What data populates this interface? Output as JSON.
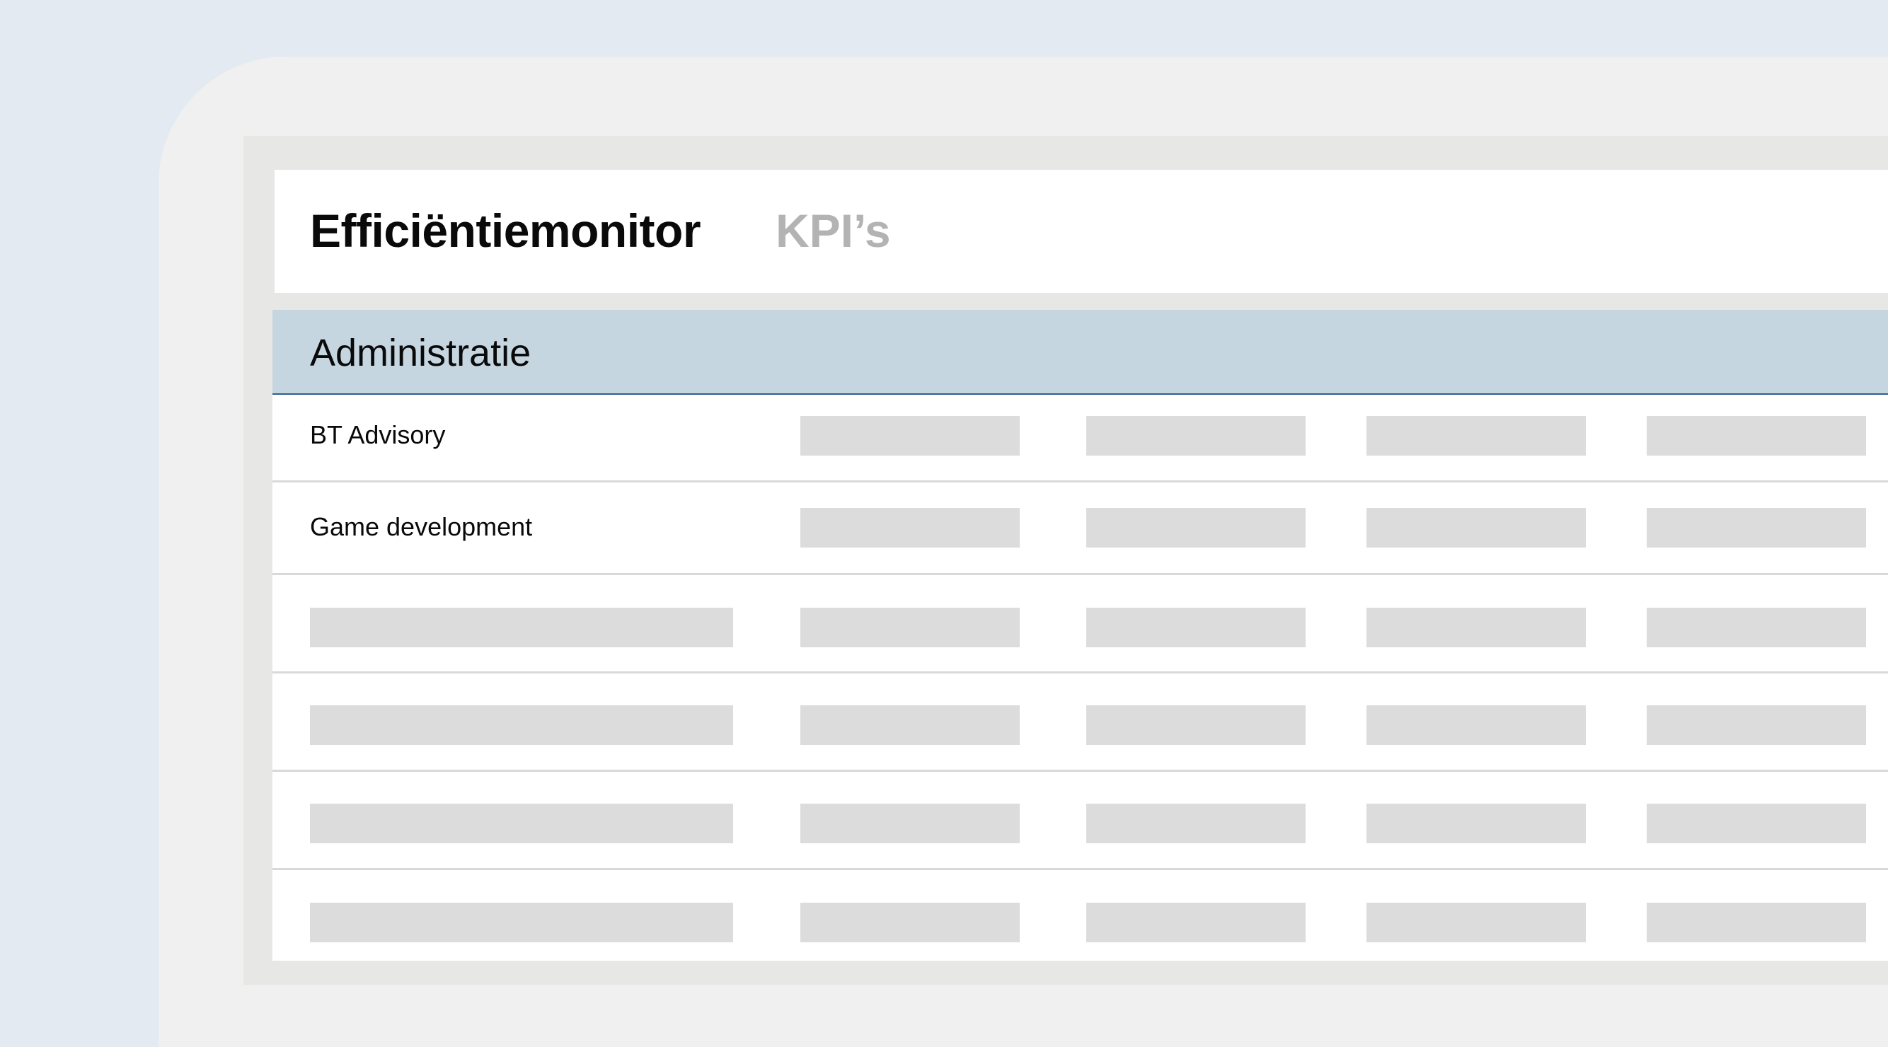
{
  "app": {
    "title": "Efficiëntiemonitor",
    "subtitle": "KPI’s"
  },
  "section": {
    "title": "Administratie"
  },
  "rows": [
    {
      "label": "BT Advisory"
    },
    {
      "label": "Game development"
    }
  ]
}
